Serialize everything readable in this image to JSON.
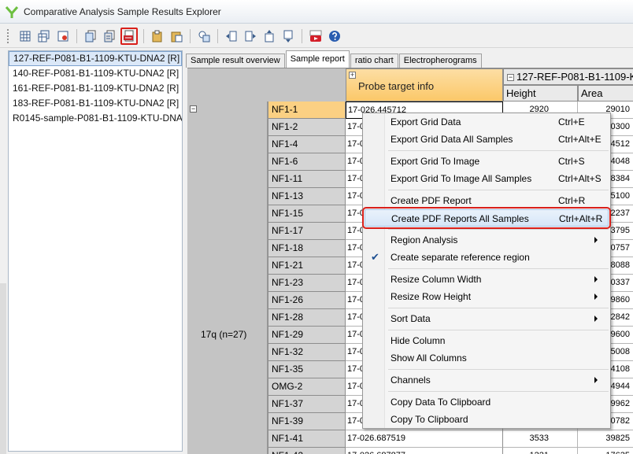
{
  "window": {
    "title": "Comparative Analysis Sample Results Explorer"
  },
  "toolbar": {
    "buttons": [
      {
        "icon": "grid-export-icon"
      },
      {
        "icon": "grid-export-all-icon"
      },
      {
        "icon": "grid-image-icon"
      },
      {
        "icon": "copy-icon"
      },
      {
        "icon": "copy-all-icon"
      },
      {
        "icon": "pdf-report-icon",
        "highlighted": true
      },
      {
        "icon": "paste-icon"
      },
      {
        "icon": "paste-all-icon"
      },
      {
        "icon": "reference-region-icon"
      },
      {
        "icon": "column-left-icon"
      },
      {
        "icon": "column-right-icon"
      },
      {
        "icon": "row-up-icon"
      },
      {
        "icon": "row-down-icon"
      },
      {
        "icon": "youtube-icon"
      },
      {
        "icon": "help-icon"
      }
    ]
  },
  "samples": [
    "127-REF-P081-B1-1109-KTU-DNA2 [R]",
    "140-REF-P081-B1-1109-KTU-DNA2 [R]",
    "161-REF-P081-B1-1109-KTU-DNA2 [R]",
    "183-REF-P081-B1-1109-KTU-DNA2 [R]",
    "R0145-sample-P081-B1-1109-KTU-DNA"
  ],
  "tabs": [
    {
      "label": "Sample result overview"
    },
    {
      "label": "Sample report",
      "active": true
    },
    {
      "label": "ratio chart"
    },
    {
      "label": "Electropherograms"
    }
  ],
  "grid": {
    "probe_header": "Probe target info",
    "expand_glyph": "+",
    "collapse_glyph": "−",
    "sample_header": "127-REF-P081-B1-1109-K",
    "columns": [
      "Height",
      "Area"
    ],
    "group_label": "17q (n=27)",
    "rows": [
      {
        "probe": "NF1-1",
        "target": "17-026.445712",
        "height": "2920",
        "area": "29010",
        "active": true
      },
      {
        "probe": "NF1-2",
        "target": "17-0",
        "height": "",
        "area": "0300"
      },
      {
        "probe": "NF1-4",
        "target": "17-0",
        "height": "",
        "area": "4512"
      },
      {
        "probe": "NF1-6",
        "target": "17-0",
        "height": "",
        "area": "4048"
      },
      {
        "probe": "NF1-11",
        "target": "17-0",
        "height": "",
        "area": "8384"
      },
      {
        "probe": "NF1-13",
        "target": "17-0",
        "height": "",
        "area": "5100"
      },
      {
        "probe": "NF1-15",
        "target": "17-0",
        "height": "",
        "area": "2237"
      },
      {
        "probe": "NF1-17",
        "target": "17-0",
        "height": "",
        "area": "3795"
      },
      {
        "probe": "NF1-18",
        "target": "17-0",
        "height": "",
        "area": "0757"
      },
      {
        "probe": "NF1-21",
        "target": "17-0",
        "height": "",
        "area": "8088"
      },
      {
        "probe": "NF1-23",
        "target": "17-0",
        "height": "",
        "area": "0337"
      },
      {
        "probe": "NF1-26",
        "target": "17-0",
        "height": "",
        "area": "9860"
      },
      {
        "probe": "NF1-28",
        "target": "17-0",
        "height": "",
        "area": "2842"
      },
      {
        "probe": "NF1-29",
        "target": "17-0",
        "height": "",
        "area": "9600"
      },
      {
        "probe": "NF1-32",
        "target": "17-0",
        "height": "",
        "area": "5008"
      },
      {
        "probe": "NF1-35",
        "target": "17-0",
        "height": "",
        "area": "4108"
      },
      {
        "probe": "OMG-2",
        "target": "17-0",
        "height": "",
        "area": "4944"
      },
      {
        "probe": "NF1-37",
        "target": "17-0",
        "height": "",
        "area": "9962"
      },
      {
        "probe": "NF1-39",
        "target": "17-0",
        "height": "",
        "area": "0782"
      },
      {
        "probe": "NF1-41",
        "target": "17-026.687519",
        "height": "3533",
        "area": "39825"
      },
      {
        "probe": "NF1-42",
        "target": "17-026.687877",
        "height": "1221",
        "area": "17635"
      }
    ]
  },
  "context_menu": {
    "items": [
      {
        "label": "Export Grid Data",
        "shortcut": "Ctrl+E"
      },
      {
        "label": "Export Grid Data All Samples",
        "shortcut": "Ctrl+Alt+E"
      },
      {
        "label": "Export Grid To Image",
        "shortcut": "Ctrl+S"
      },
      {
        "label": "Export Grid To Image All Samples",
        "shortcut": "Ctrl+Alt+S"
      },
      {
        "label": "Create PDF Report",
        "shortcut": "Ctrl+R"
      },
      {
        "label": "Create PDF Reports All Samples",
        "shortcut": "Ctrl+Alt+R",
        "highlighted": true
      },
      {
        "label": "Region Analysis",
        "submenu": true
      },
      {
        "label": "Create separate reference region",
        "checked": true
      },
      {
        "label": "Resize Column Width",
        "submenu": true
      },
      {
        "label": "Resize Row Height",
        "submenu": true
      },
      {
        "label": "Sort Data",
        "submenu": true
      },
      {
        "label": "Hide Column"
      },
      {
        "label": "Show All Columns"
      },
      {
        "label": "Channels",
        "submenu": true
      },
      {
        "label": "Copy Data To Clipboard"
      },
      {
        "label": "Copy To Clipboard"
      }
    ],
    "check_glyph": "✔"
  },
  "colors": {
    "accent_header": "#fbc869",
    "highlight_outline": "#d9201b",
    "selection": "#dbe8f8"
  }
}
